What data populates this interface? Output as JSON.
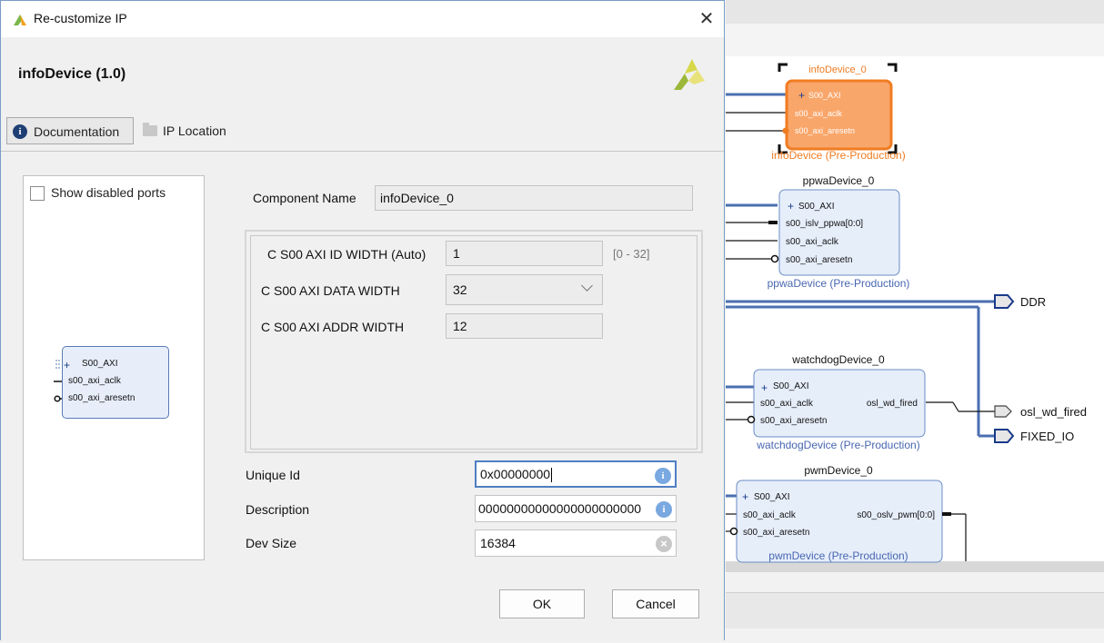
{
  "dialog": {
    "window_title": "Re-customize IP",
    "ip_name": "infoDevice (1.0)",
    "tabs": [
      {
        "label": "Documentation",
        "icon": "info-icon"
      },
      {
        "label": "IP Location",
        "icon": "folder-icon"
      }
    ],
    "show_disabled_ports_label": "Show disabled ports",
    "show_disabled_ports_checked": false,
    "preview_ports": [
      "S00_AXI",
      "s00_axi_aclk",
      "s00_axi_aresetn"
    ],
    "component_name_label": "Component Name",
    "component_name_value": "infoDevice_0",
    "params": {
      "id_width_label": "C S00 AXI ID WIDTH (Auto)",
      "id_width_value": "1",
      "id_width_range": "[0 - 32]",
      "data_width_label": "C S00 AXI DATA WIDTH",
      "data_width_value": "32",
      "addr_width_label": "C S00 AXI ADDR WIDTH",
      "addr_width_value": "12"
    },
    "unique_id_label": "Unique Id",
    "unique_id_value": "0x00000000",
    "description_label": "Description",
    "description_value": "00000000000000000000000",
    "dev_size_label": "Dev Size",
    "dev_size_value": "16384",
    "ok_label": "OK",
    "cancel_label": "Cancel"
  },
  "diagram": {
    "blocks": [
      {
        "name": "infoDevice_0",
        "subtitle": "infoDevice (Pre-Production)",
        "ports_left": [
          "S00_AXI",
          "s00_axi_aclk",
          "s00_axi_aresetn"
        ],
        "ports_right": [],
        "selected": true
      },
      {
        "name": "ppwaDevice_0",
        "subtitle": "ppwaDevice (Pre-Production)",
        "ports_left": [
          "S00_AXI",
          "s00_islv_ppwa[0:0]",
          "s00_axi_aclk",
          "s00_axi_aresetn"
        ],
        "ports_right": []
      },
      {
        "name": "watchdogDevice_0",
        "subtitle": "watchdogDevice (Pre-Production)",
        "ports_left": [
          "S00_AXI",
          "s00_axi_aclk",
          "s00_axi_aresetn"
        ],
        "ports_right": [
          "osl_wd_fired"
        ]
      },
      {
        "name": "pwmDevice_0",
        "subtitle": "pwmDevice (Pre-Production)",
        "ports_left": [
          "S00_AXI",
          "s00_axi_aclk",
          "s00_axi_aresetn"
        ],
        "ports_right": [
          "s00_oslv_pwm[0:0]"
        ]
      }
    ],
    "external_ports": [
      "DDR",
      "osl_wd_fired",
      "FIXED_IO"
    ],
    "colors": {
      "block_fill": "#e6eefa",
      "block_border": "#6a8cc4",
      "selected_fill": "#f9a66a",
      "selected_border": "#f07c22",
      "subtitle_blue": "#4866b0",
      "subtitle_orange": "#f07c22",
      "bus_line": "#4a6fb0"
    }
  }
}
